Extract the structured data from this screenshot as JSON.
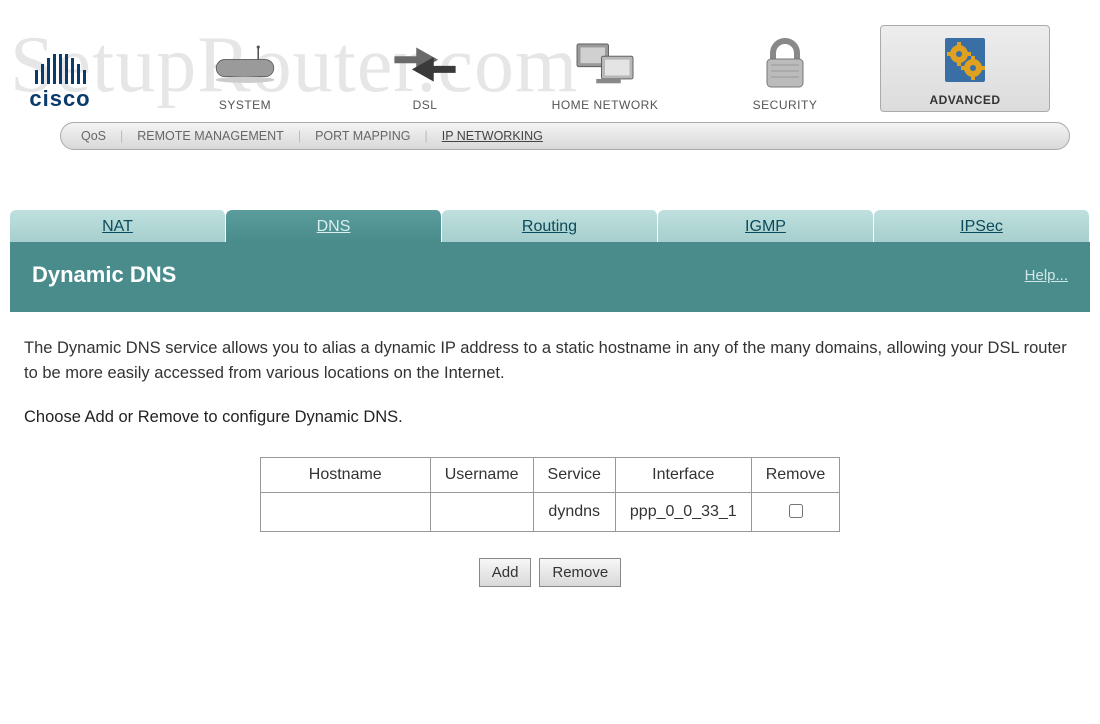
{
  "watermark": "SetupRouter.com",
  "brand": "cisco",
  "categories": [
    {
      "label": "SYSTEM",
      "icon": "router-icon",
      "active": false
    },
    {
      "label": "DSL",
      "icon": "arrows-icon",
      "active": false
    },
    {
      "label": "HOME NETWORK",
      "icon": "computers-icon",
      "active": false
    },
    {
      "label": "SECURITY",
      "icon": "padlock-icon",
      "active": false
    },
    {
      "label": "ADVANCED",
      "icon": "gears-icon",
      "active": true
    }
  ],
  "subnav": [
    {
      "label": "QoS",
      "active": false
    },
    {
      "label": "REMOTE MANAGEMENT",
      "active": false
    },
    {
      "label": "PORT MAPPING",
      "active": false
    },
    {
      "label": "IP NETWORKING",
      "active": true
    }
  ],
  "tabs": [
    {
      "label": "NAT",
      "active": false
    },
    {
      "label": "DNS",
      "active": true
    },
    {
      "label": "Routing",
      "active": false
    },
    {
      "label": "IGMP",
      "active": false
    },
    {
      "label": "IPSec",
      "active": false
    }
  ],
  "section": {
    "title": "Dynamic DNS",
    "help": "Help..."
  },
  "description": "The Dynamic DNS service allows you to alias a dynamic IP address to a static hostname in any of the many domains, allowing your DSL router to be more easily accessed from various locations on the Internet.",
  "instruction": "Choose Add or Remove to configure Dynamic DNS.",
  "table": {
    "headers": [
      "Hostname",
      "Username",
      "Service",
      "Interface",
      "Remove"
    ],
    "rows": [
      {
        "hostname": "",
        "username": "",
        "service": "dyndns",
        "interface": "ppp_0_0_33_1",
        "remove": false
      }
    ]
  },
  "buttons": {
    "add": "Add",
    "remove": "Remove"
  }
}
